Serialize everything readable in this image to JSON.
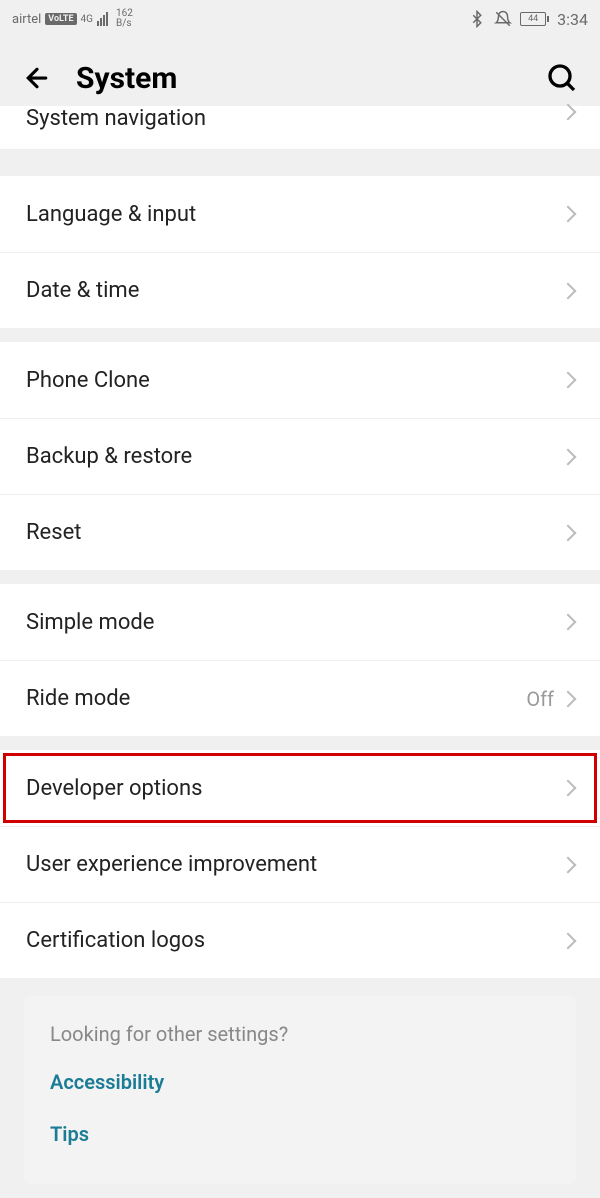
{
  "statusbar": {
    "carrier": "airtel",
    "volte": "VoLTE",
    "network_type": "4G",
    "speed_value": "162",
    "speed_unit": "B/s",
    "battery": "44",
    "time": "3:34"
  },
  "header": {
    "title": "System"
  },
  "groups": [
    {
      "partial": true,
      "items": [
        {
          "label": "System navigation",
          "value": ""
        }
      ]
    },
    {
      "items": [
        {
          "label": "Language & input",
          "value": ""
        },
        {
          "label": "Date & time",
          "value": ""
        }
      ]
    },
    {
      "items": [
        {
          "label": "Phone Clone",
          "value": ""
        },
        {
          "label": "Backup & restore",
          "value": ""
        },
        {
          "label": "Reset",
          "value": ""
        }
      ]
    },
    {
      "items": [
        {
          "label": "Simple mode",
          "value": ""
        },
        {
          "label": "Ride mode",
          "value": "Off"
        }
      ]
    },
    {
      "items": [
        {
          "label": "Developer options",
          "value": "",
          "highlighted": true
        },
        {
          "label": "User experience improvement",
          "value": ""
        },
        {
          "label": "Certification logos",
          "value": ""
        }
      ]
    }
  ],
  "footer": {
    "title": "Looking for other settings?",
    "links": [
      "Accessibility",
      "Tips"
    ]
  }
}
